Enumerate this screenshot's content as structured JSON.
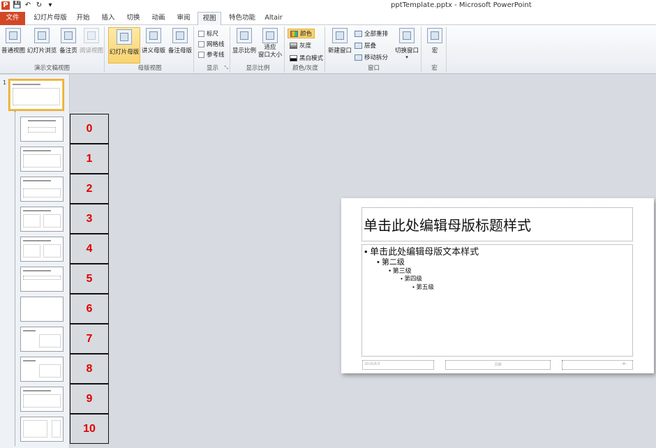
{
  "window": {
    "title": "pptTemplate.pptx - Microsoft PowerPoint"
  },
  "qat": {
    "logo": "P",
    "icons": [
      "save-icon",
      "undo-icon",
      "redo-icon",
      "customize-icon"
    ]
  },
  "tabs": [
    "文件",
    "幻灯片母版",
    "开始",
    "插入",
    "切换",
    "动画",
    "审阅",
    "视图",
    "特色功能",
    "Altair"
  ],
  "ribbon": {
    "presentation_views": {
      "label": "演示文稿视图",
      "buttons": [
        "普通视图",
        "幻灯片浏览",
        "备注页",
        "阅读视图"
      ]
    },
    "master_views": {
      "label": "母版视图",
      "buttons": [
        "幻灯片母版",
        "讲义母版",
        "备注母版"
      ]
    },
    "show": {
      "label": "显示",
      "items": [
        "标尺",
        "网格线",
        "参考线"
      ]
    },
    "zoom": {
      "label": "显示比例",
      "buttons": [
        "显示比例",
        "适应\n窗口大小"
      ]
    },
    "color": {
      "label": "颜色/灰度",
      "items": [
        "颜色",
        "灰度",
        "黑白模式"
      ]
    },
    "window": {
      "label": "窗口",
      "new_window": "新建窗口",
      "items": [
        "全部重排",
        "层叠",
        "移动拆分"
      ],
      "switch": "切换窗口"
    },
    "macro": {
      "label": "宏",
      "button": "宏"
    }
  },
  "thumbnails": {
    "master_number": "1"
  },
  "layout_numbers": [
    "0",
    "1",
    "2",
    "3",
    "4",
    "5",
    "6",
    "7",
    "8",
    "9",
    "10"
  ],
  "slide": {
    "title": "单击此处编辑母版标题样式",
    "levels": [
      "单击此处编辑母版文本样式",
      "第二级",
      "第三级",
      "第四级",
      "第五级"
    ],
    "footer_date": "2016/6/3",
    "footer_text": "页脚",
    "footer_num": "‹#›"
  },
  "colors": {
    "file_tab": "#d24726",
    "number_text": "#e00000",
    "selected_button": "#f9d46f"
  }
}
